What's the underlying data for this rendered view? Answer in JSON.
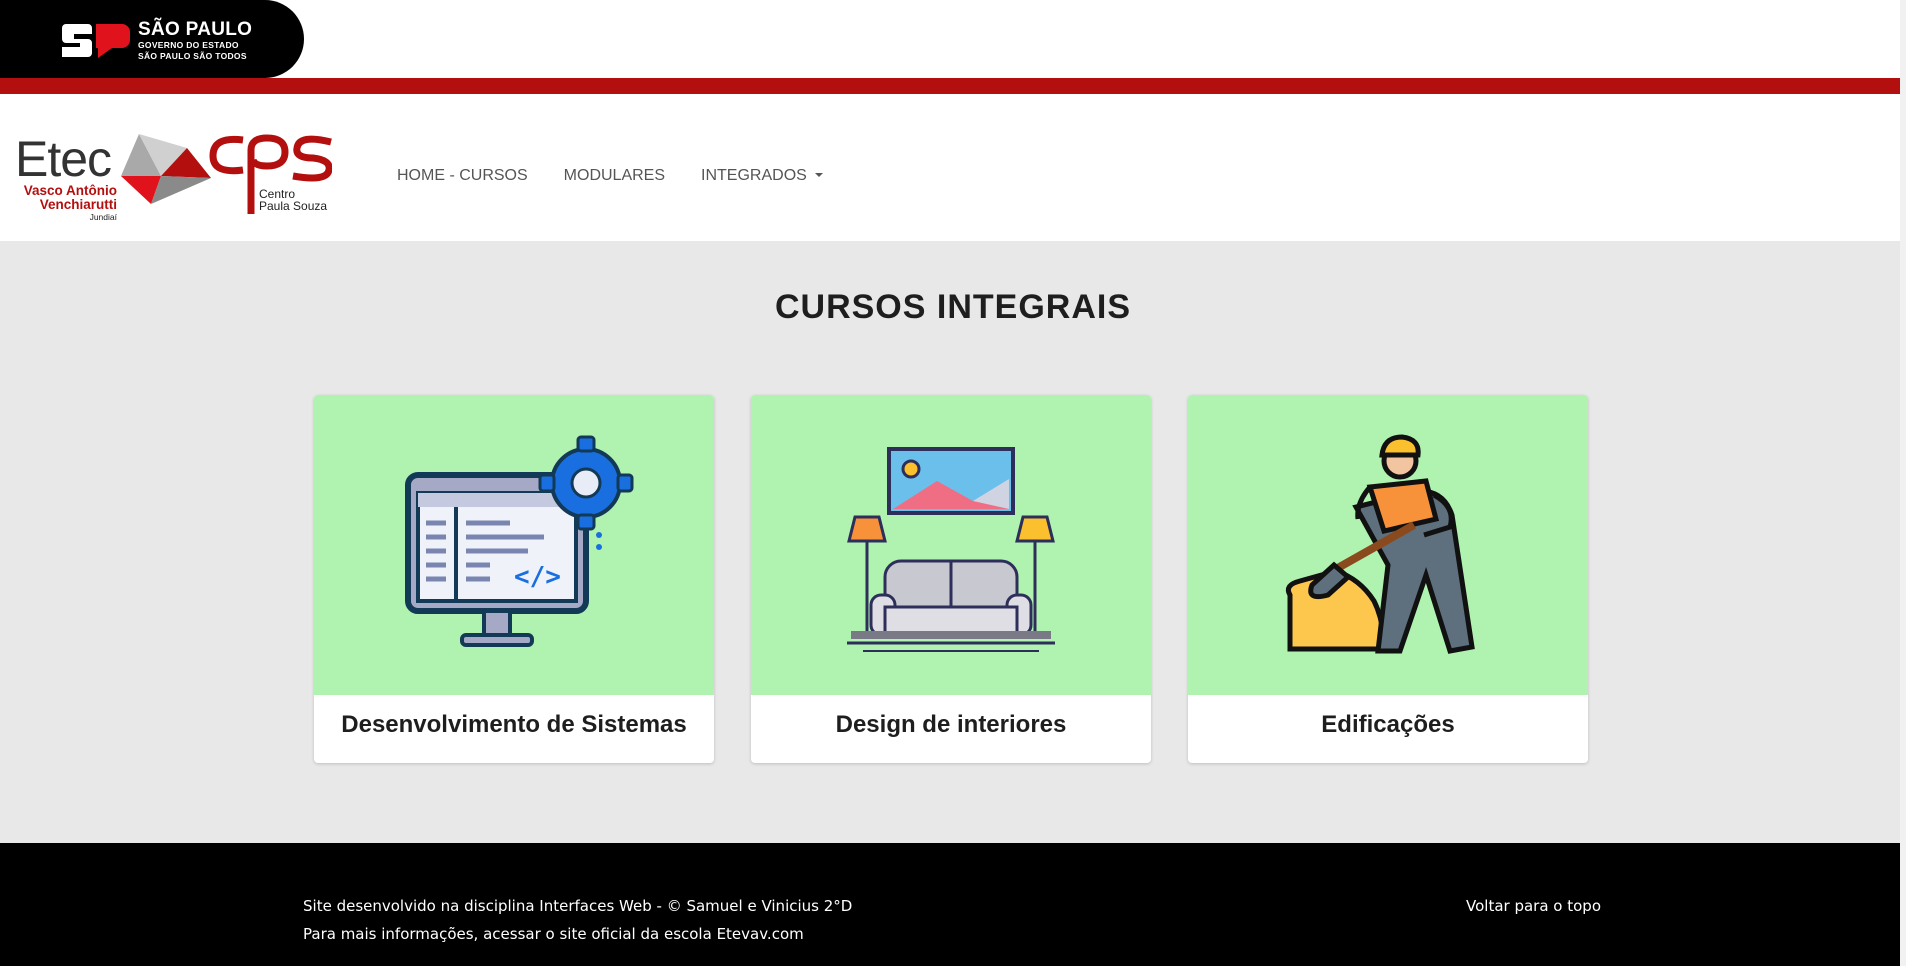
{
  "gov": {
    "line1": "SÃO PAULO",
    "line2": "GOVERNO DO ESTADO",
    "line3": "SÃO PAULO SÃO TODOS"
  },
  "logos": {
    "etec_word": "Etec",
    "etec_name": "Vasco Antônio Venchiarutti",
    "etec_city": "Jundiaí",
    "cps_name": "Centro Paula Souza",
    "colors": {
      "red": "#b40f0f"
    }
  },
  "nav": {
    "items": [
      {
        "label": "HOME - CURSOS"
      },
      {
        "label": "MODULARES"
      },
      {
        "label": "INTEGRADOS",
        "has_dropdown": true
      }
    ]
  },
  "main": {
    "title": "CURSOS INTEGRAIS",
    "cards": [
      {
        "title": "Desenvolvimento de Sistemas",
        "icon": "computer-code-gear-icon"
      },
      {
        "title": "Design de interiores",
        "icon": "sofa-living-room-icon"
      },
      {
        "title": "Edificações",
        "icon": "construction-worker-icon"
      }
    ],
    "card_bg": "#b0f2b0"
  },
  "footer": {
    "line1": "Site desenvolvido na disciplina Interfaces Web - © Samuel e Vinicius 2°D",
    "line2_prefix": "Para mais informações, acessar o site oficial da escola ",
    "line2_link": "Etevav.com",
    "back_to_top": "Voltar para o topo"
  }
}
